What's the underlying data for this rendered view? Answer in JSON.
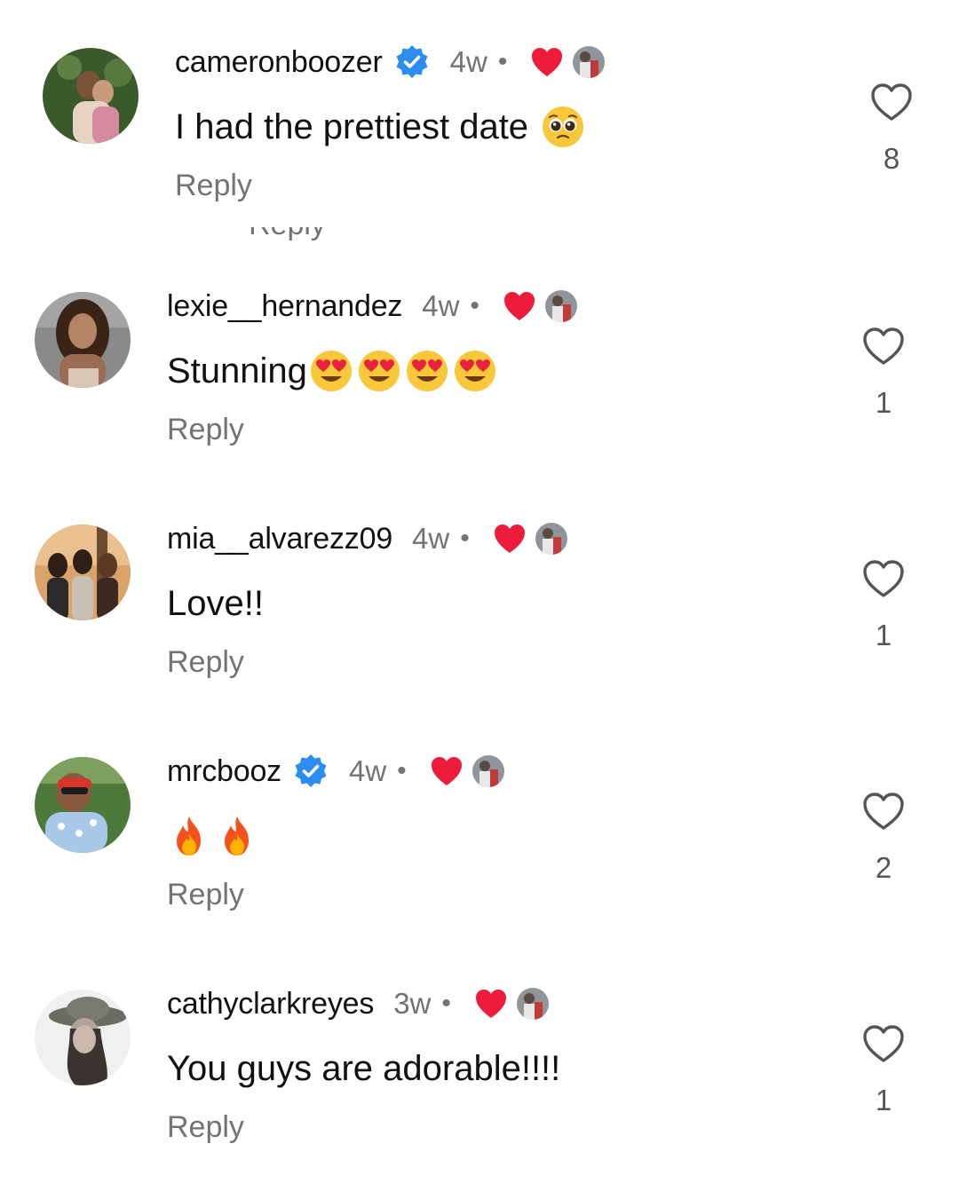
{
  "comments": [
    {
      "username": "cameronboozer",
      "verified": true,
      "time": "4w",
      "separator": "•",
      "text": "I had the prettiest date",
      "text_emoji": [
        "pleading-face"
      ],
      "reply_label": "Reply",
      "like_count": "8",
      "avatar_colors": [
        "#3b5a2c",
        "#c79b7c"
      ]
    },
    {
      "username": "lexie__hernandez",
      "verified": false,
      "time": "4w",
      "separator": "•",
      "text": "Stunning",
      "text_emoji": [
        "heart-eyes",
        "heart-eyes",
        "heart-eyes",
        "heart-eyes"
      ],
      "reply_label": "Reply",
      "like_count": "1",
      "avatar_colors": [
        "#8a8a8a",
        "#b58466"
      ]
    },
    {
      "username": "mia__alvarezz09",
      "verified": false,
      "time": "4w",
      "separator": "•",
      "text": "Love!!",
      "text_emoji": [],
      "reply_label": "Reply",
      "like_count": "1",
      "avatar_colors": [
        "#d9a36a",
        "#3a2a22"
      ]
    },
    {
      "username": "mrcbooz",
      "verified": true,
      "time": "4w",
      "separator": "•",
      "text": "",
      "text_emoji": [
        "fire",
        "fire"
      ],
      "reply_label": "Reply",
      "like_count": "2",
      "avatar_colors": [
        "#4d7a3a",
        "#a9c7e6"
      ]
    },
    {
      "username": "cathyclarkreyes",
      "verified": false,
      "time": "3w",
      "separator": "•",
      "text": "You guys are adorable!!!!",
      "text_emoji": [],
      "reply_label": "Reply",
      "like_count": "1",
      "avatar_colors": [
        "#f0f0f0",
        "#6b6b63"
      ]
    }
  ],
  "ghost_reply_text": "Reply",
  "colors": {
    "liked_heart": "#ed1c3b",
    "verified_badge": "#2d8cf0",
    "secondary_text": "#737373"
  },
  "icons": {
    "like": "heart-outline-icon",
    "creator_liked": "red-heart-icon",
    "verified": "verified-badge-icon"
  }
}
